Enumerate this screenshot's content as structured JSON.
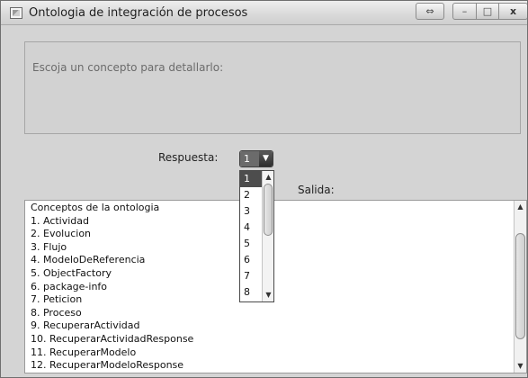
{
  "window": {
    "title": "Ontologia de integración de procesos",
    "buttons": {
      "restore": "⇔",
      "minimize": "–",
      "maximize": "□",
      "close": "x"
    }
  },
  "message": "Escoja  un concepto para detallarlo:",
  "response": {
    "label": "Respuesta:",
    "selected": "1",
    "arrow": "▼",
    "options": [
      "1",
      "2",
      "3",
      "4",
      "5",
      "6",
      "7",
      "8"
    ]
  },
  "output": {
    "label": "Salida:",
    "lines": [
      "Conceptos de la ontologia",
      "1. Actividad",
      "2. Evolucion",
      "3. Flujo",
      "4. ModeloDeReferencia",
      "5. ObjectFactory",
      "6. package-info",
      "7. Peticion",
      "8. Proceso",
      "9. RecuperarActividad",
      "10. RecuperarActividadResponse",
      "11. RecuperarModelo",
      "12. RecuperarModeloResponse"
    ]
  },
  "icons": {
    "scroll_up": "▲",
    "scroll_down": "▼"
  }
}
